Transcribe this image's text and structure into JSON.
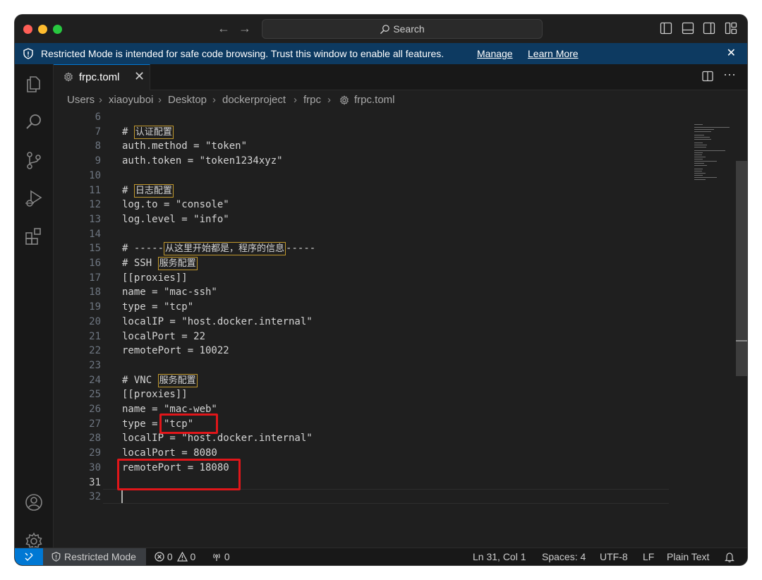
{
  "titlebar": {
    "search_placeholder": "Search"
  },
  "banner": {
    "message": "Restricted Mode is intended for safe code browsing. Trust this window to enable all features.",
    "manage_label": "Manage",
    "learn_more_label": "Learn More",
    "close_symbol": "✕",
    "background": "#0d3a61"
  },
  "tab": {
    "label": "frpc.toml",
    "close_symbol": "✕",
    "more_symbol": "···"
  },
  "breadcrumb": {
    "items": [
      "Users",
      "xiaoyuboi",
      "Desktop",
      "dockerproject",
      "frpc",
      "frpc.toml"
    ],
    "separator": "›"
  },
  "editor": {
    "lines": [
      {
        "n": "6",
        "text": ""
      },
      {
        "n": "7",
        "pre": "# ",
        "cjk": "认证配置",
        "post": ""
      },
      {
        "n": "8",
        "text": "auth.method = \"token\""
      },
      {
        "n": "9",
        "text": "auth.token = \"token1234xyz\""
      },
      {
        "n": "10",
        "text": ""
      },
      {
        "n": "11",
        "pre": "# ",
        "cjk": "日志配置",
        "post": ""
      },
      {
        "n": "12",
        "text": "log.to = \"console\""
      },
      {
        "n": "13",
        "text": "log.level = \"info\""
      },
      {
        "n": "14",
        "text": ""
      },
      {
        "n": "15",
        "pre": "# -----",
        "cjk": "从这里开始都是，程序的信息",
        "post": "-----"
      },
      {
        "n": "16",
        "pre": "# SSH ",
        "cjk": "服务配置",
        "post": ""
      },
      {
        "n": "17",
        "text": "[[proxies]]"
      },
      {
        "n": "18",
        "text": "name = \"mac-ssh\""
      },
      {
        "n": "19",
        "text": "type = \"tcp\""
      },
      {
        "n": "20",
        "text": "localIP = \"host.docker.internal\""
      },
      {
        "n": "21",
        "text": "localPort = 22"
      },
      {
        "n": "22",
        "text": "remotePort = 10022"
      },
      {
        "n": "23",
        "text": ""
      },
      {
        "n": "24",
        "pre": "# VNC ",
        "cjk": "服务配置",
        "post": ""
      },
      {
        "n": "25",
        "text": "[[proxies]]"
      },
      {
        "n": "26",
        "text": "name = \"mac-web\""
      },
      {
        "n": "27",
        "text": "type = \"tcp\""
      },
      {
        "n": "28",
        "text": "localIP = \"host.docker.internal\""
      },
      {
        "n": "29",
        "text": "localPort = 8080"
      },
      {
        "n": "30",
        "text": "remotePort = 18080"
      },
      {
        "n": "31",
        "text": "",
        "active": true
      },
      {
        "n": "32",
        "text": ""
      }
    ],
    "highlight_color": "#e0161a"
  },
  "statusbar": {
    "restricted_mode": "Restricted Mode",
    "errors": "0",
    "warnings": "0",
    "ports": "0",
    "cursor_position": "Ln 31, Col 1",
    "indentation": "Spaces: 4",
    "encoding": "UTF-8",
    "eol": "LF",
    "language": "Plain Text",
    "accent": "#0078d4"
  },
  "icons": {
    "activity": [
      "explorer-icon",
      "search-icon",
      "source-control-icon",
      "run-debug-icon",
      "extensions-icon",
      "account-icon",
      "settings-gear-icon"
    ]
  }
}
